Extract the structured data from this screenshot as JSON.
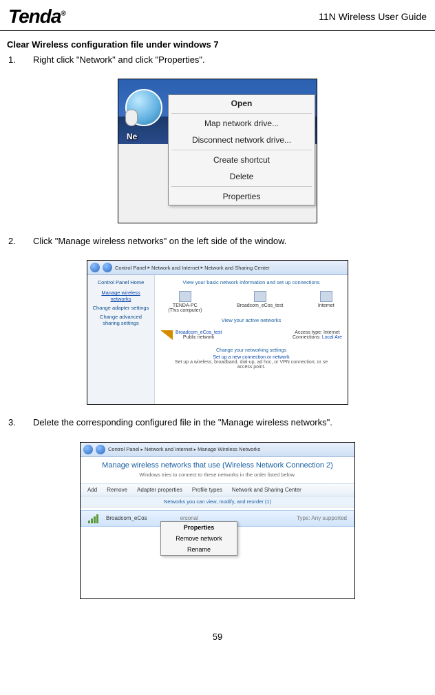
{
  "header": {
    "logo_main": "Tenda",
    "logo_r": "®",
    "title_prefix": "11N Wireless ",
    "title_suffix": "User Guide"
  },
  "section_title": "Clear Wireless configuration file under windows 7",
  "steps": [
    {
      "num": "1.",
      "text": "Right click \"Network\" and click \"Properties\"."
    },
    {
      "num": "2.",
      "text": "Click \"Manage wireless networks\" on the left side of the window."
    },
    {
      "num": "3.",
      "text": "Delete the corresponding configured file in the \"Manage wireless networks\"."
    }
  ],
  "fig1": {
    "ne_label": "Ne",
    "menu": {
      "open": "Open",
      "map": "Map network drive...",
      "disconnect": "Disconnect network drive...",
      "shortcut": "Create shortcut",
      "delete": "Delete",
      "properties": "Properties"
    }
  },
  "fig2": {
    "breadcrumb": [
      "Control Panel",
      "Network and Internet",
      "Network and Sharing Center"
    ],
    "left": {
      "heading": "Control Panel Home",
      "links": [
        "Manage wireless networks",
        "Change adapter settings",
        "Change advanced sharing settings"
      ]
    },
    "right": {
      "title": "View your basic network information and set up connections",
      "nodes": [
        {
          "name": "TENDA-PC",
          "sub": "(This computer)"
        },
        {
          "name": "Broadcom_eCos_test",
          "sub": ""
        },
        {
          "name": "Internet",
          "sub": ""
        }
      ],
      "active_label": "View your active networks",
      "active_name": "Broadcom_eCos_test",
      "active_type": "Public network",
      "access_label": "Access type:",
      "access_value": "Internet",
      "conn_label": "Connections:",
      "conn_value": "Local Are",
      "change_heading": "Change your networking settings",
      "setup_link": "Set up a new connection or network",
      "setup_text": "Set up a wireless, broadband, dial-up, ad hoc, or VPN connection; or se",
      "setup_text2": "access point."
    }
  },
  "fig3": {
    "breadcrumb": [
      "Control Panel",
      "Network and Internet",
      "Manage Wireless Networks"
    ],
    "banner_title": "Manage wireless networks that use (Wireless Network Connection 2)",
    "banner_sub": "Windows tries to connect to these networks in the order listed below.",
    "toolbar": [
      "Add",
      "Remove",
      "Adapter properties",
      "Profile types",
      "Network and Sharing Center"
    ],
    "group_bar": "Networks you can view, modify, and reorder (1)",
    "row": {
      "name": "Broadcom_eCos",
      "security": "ersonal",
      "type_label": "Type:",
      "type_value": "Any supported"
    },
    "ctx": {
      "properties": "Properties",
      "remove": "Remove network",
      "rename": "Rename"
    }
  },
  "page_number": "59"
}
